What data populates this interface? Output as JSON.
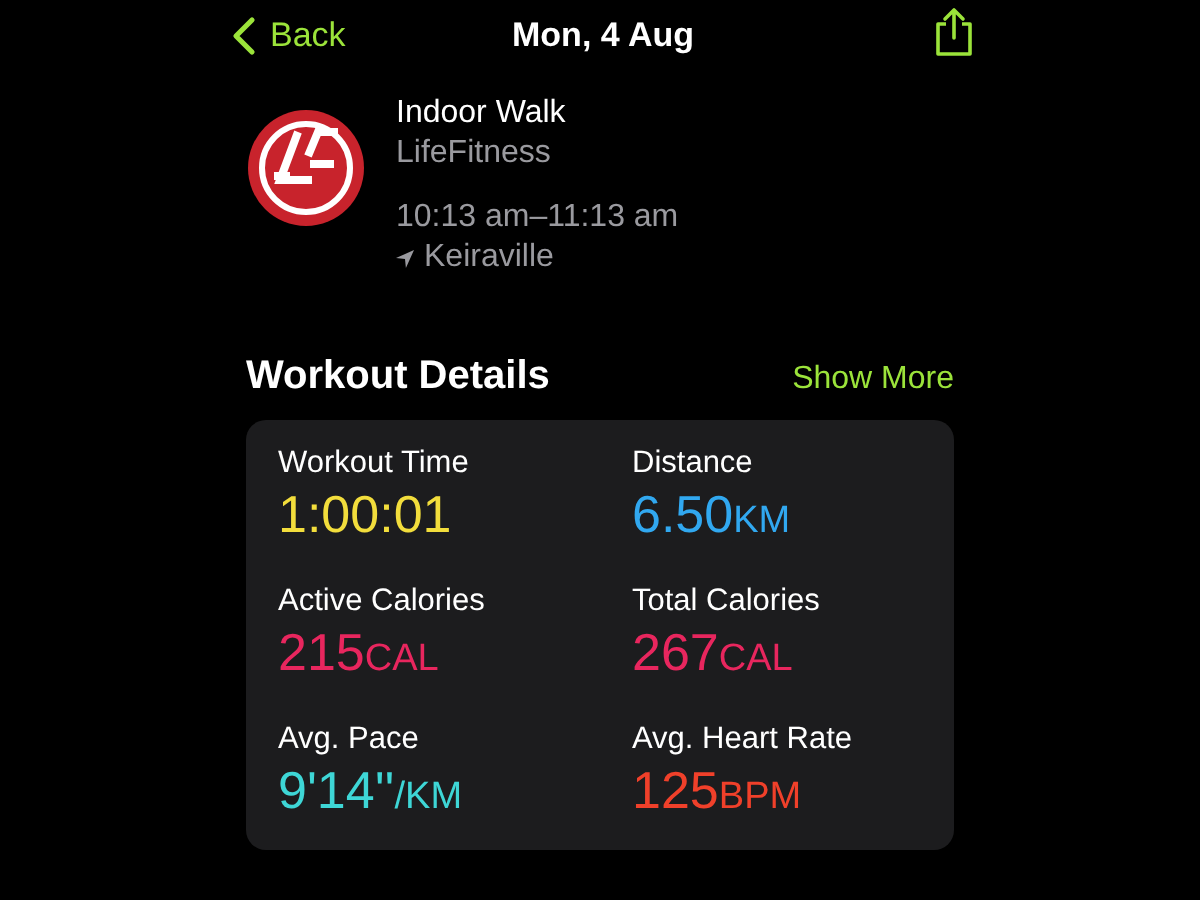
{
  "nav": {
    "back": "Back",
    "title": "Mon, 4 Aug"
  },
  "workout": {
    "name": "Indoor Walk",
    "source": "LifeFitness",
    "time": "10:13 am–11:13 am",
    "location": "Keiraville"
  },
  "section": {
    "title": "Workout Details",
    "action": "Show More"
  },
  "metrics": [
    {
      "label": "Workout Time",
      "value": "1:00:01",
      "color": "#f2dd3c"
    },
    {
      "label": "Distance",
      "value": "6.50",
      "unit": "KM",
      "color": "#31a8f0"
    },
    {
      "label": "Active Calories",
      "value": "215",
      "unit": "CAL",
      "color": "#e8265e"
    },
    {
      "label": "Total Calories",
      "value": "267",
      "unit": "CAL",
      "color": "#e8265e"
    },
    {
      "label": "Avg. Pace",
      "value": "9'14''",
      "unit": "/KM",
      "color": "#3ed6d6"
    },
    {
      "label": "Avg. Heart Rate",
      "value": "125",
      "unit": "BPM",
      "color": "#f0402a"
    }
  ]
}
